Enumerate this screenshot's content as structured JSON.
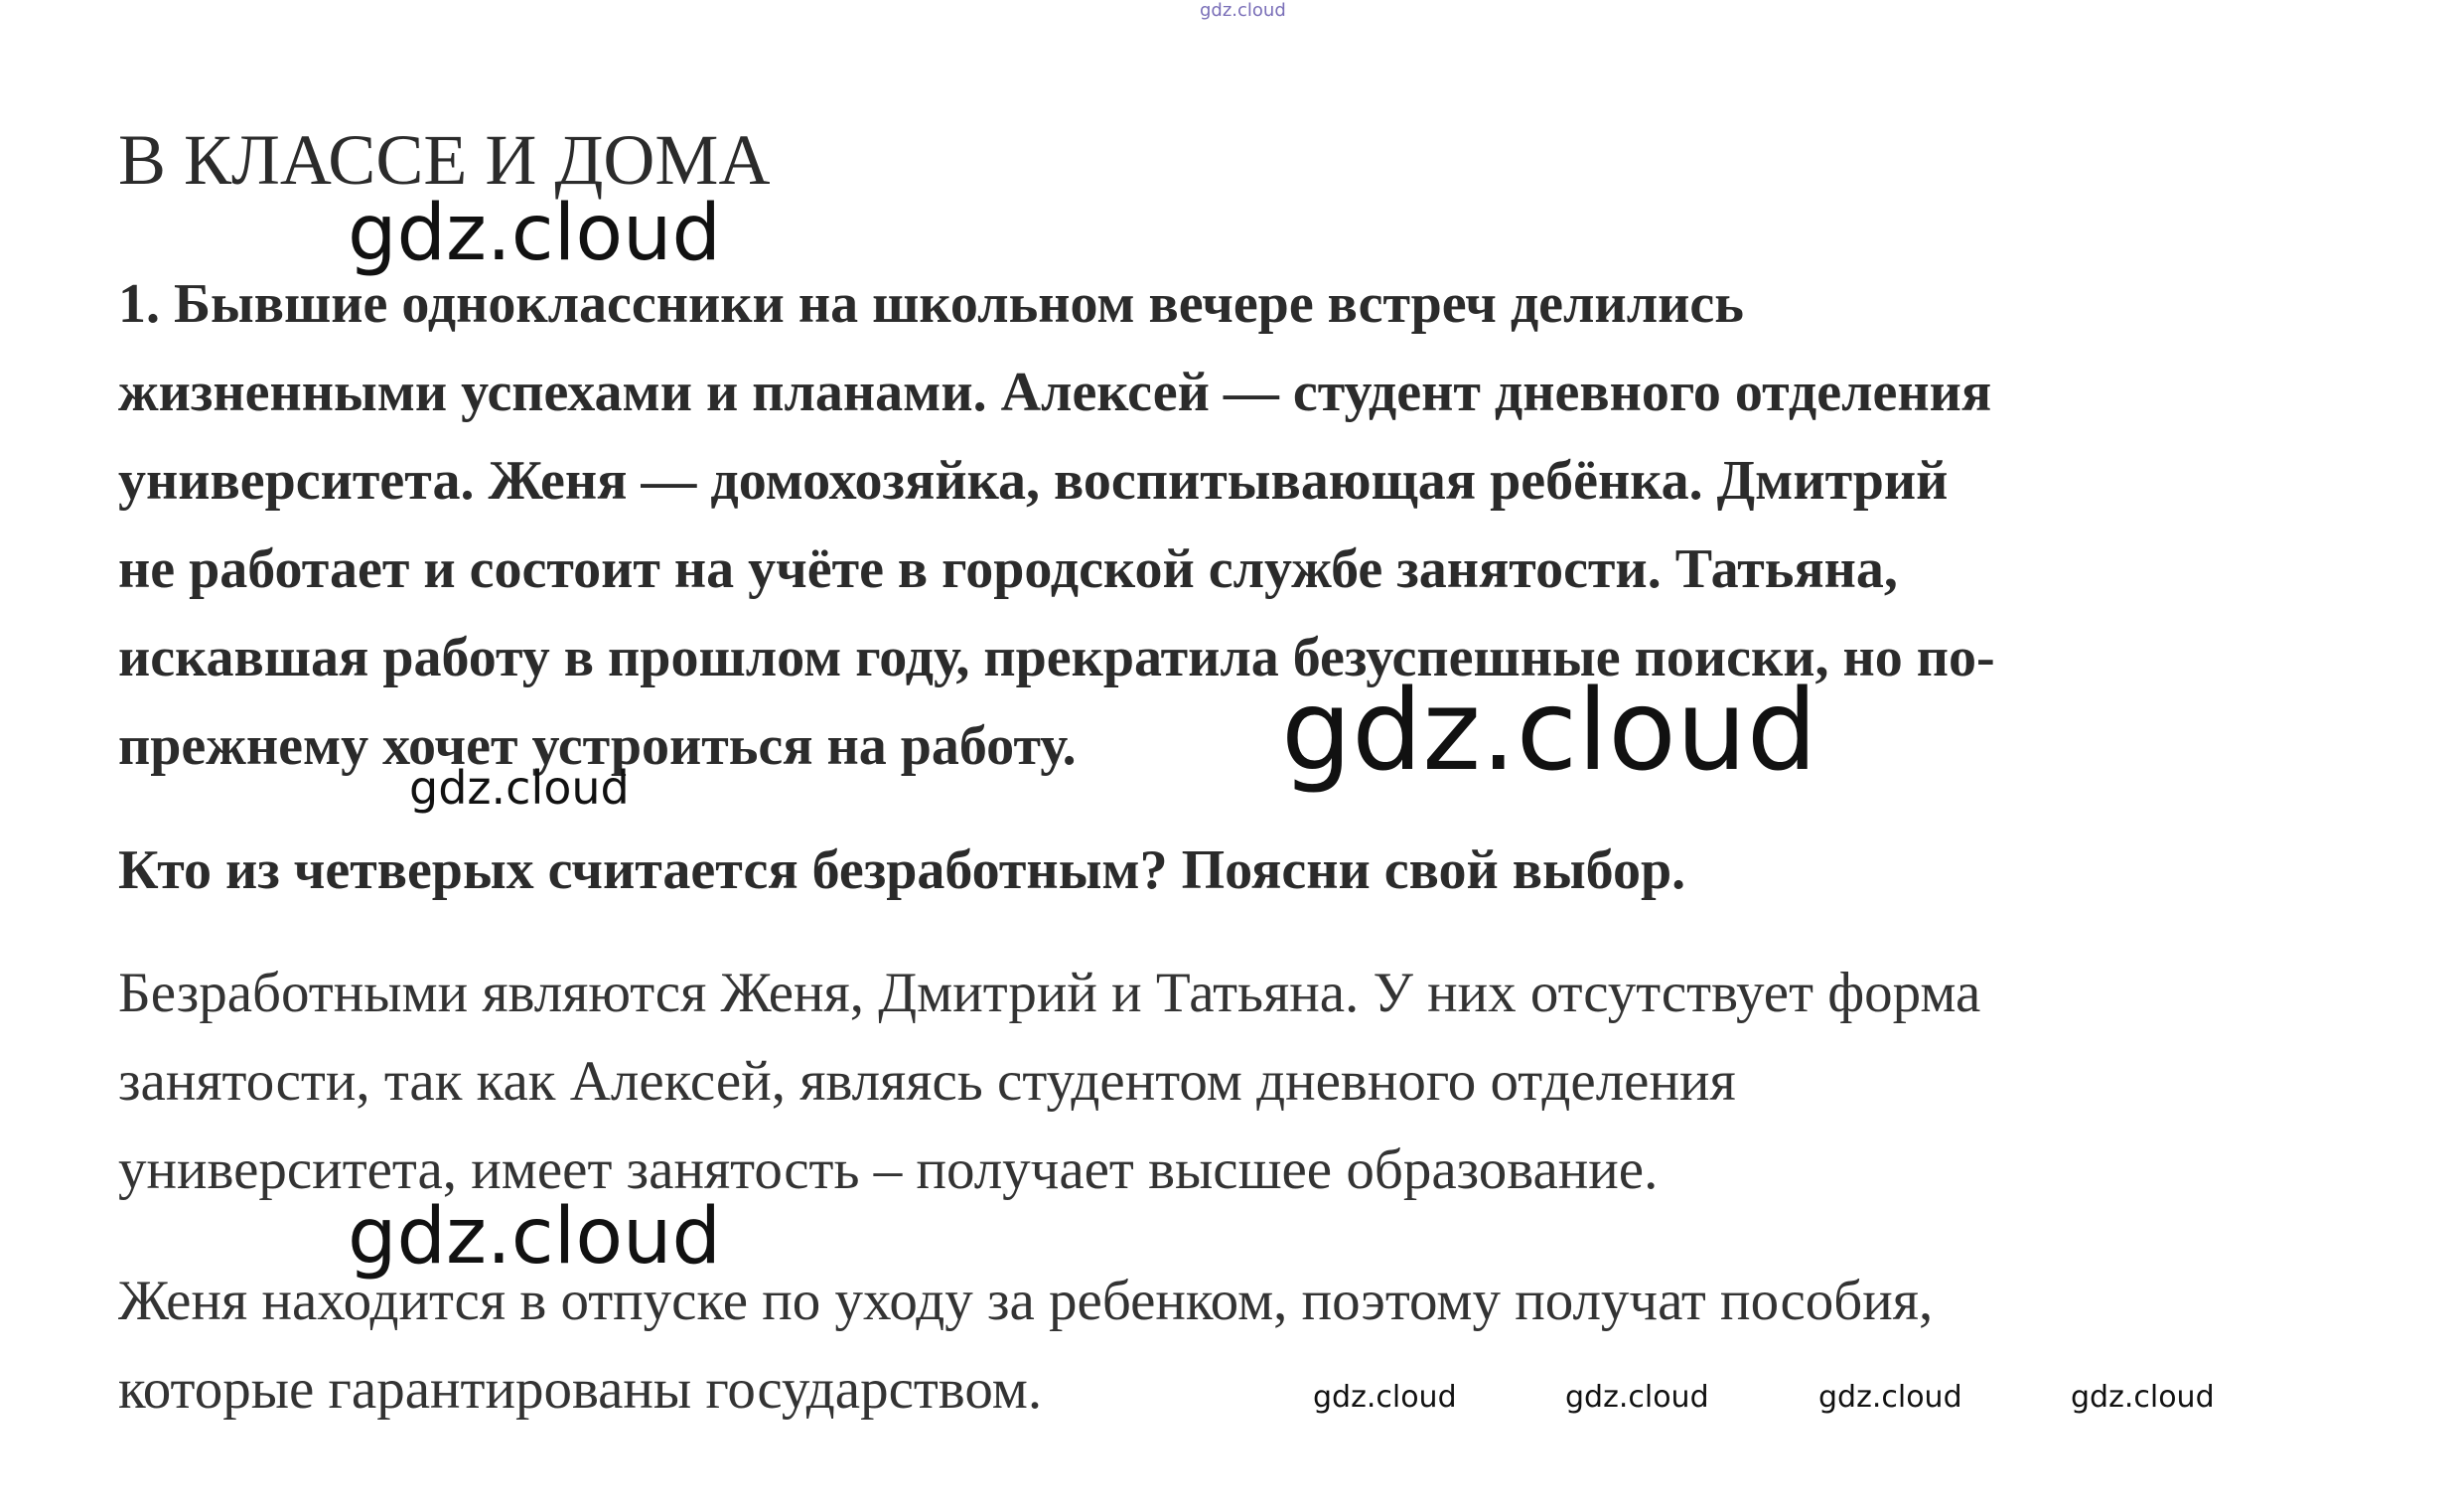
{
  "document": {
    "heading": "В КЛАССЕ И ДОМА",
    "task": {
      "lines": [
        "1. Бывшие одноклассники на школьном вечере встреч делились",
        "жизненными успехами и планами. Алексей — студент дневного отделения",
        "университета. Женя — домохозяйка, воспитывающая ребёнка. Дмитрий",
        "не работает и состоит на учёте в городской службе занятости. Татьяна,",
        "искавшая работу в прошлом году, прекратила безуспешные поиски, но по-",
        "прежнему хочет устроиться на работу."
      ],
      "question": "Кто из четверых считается безработным? Поясни свой выбор."
    },
    "answer": {
      "paragraph1": [
        "Безработными являются Женя, Дмитрий и Татьяна. У них отсутствует форма",
        "занятости, так как Алексей, являясь студентом дневного отделения",
        "университета, имеет занятость – получает высшее образование."
      ],
      "paragraph2": [
        "Женя находится в отпуске по уходу за ребенком, поэтому получат пособия,",
        "которые гарантированы государством."
      ]
    }
  },
  "watermarks": {
    "top": "gdz.cloud",
    "a": "gdz.cloud",
    "b": "gdz.cloud",
    "c": "gdz.cloud",
    "d": "gdz.cloud",
    "row": [
      "gdz.cloud",
      "gdz.cloud",
      "gdz.cloud",
      "gdz.cloud"
    ]
  }
}
